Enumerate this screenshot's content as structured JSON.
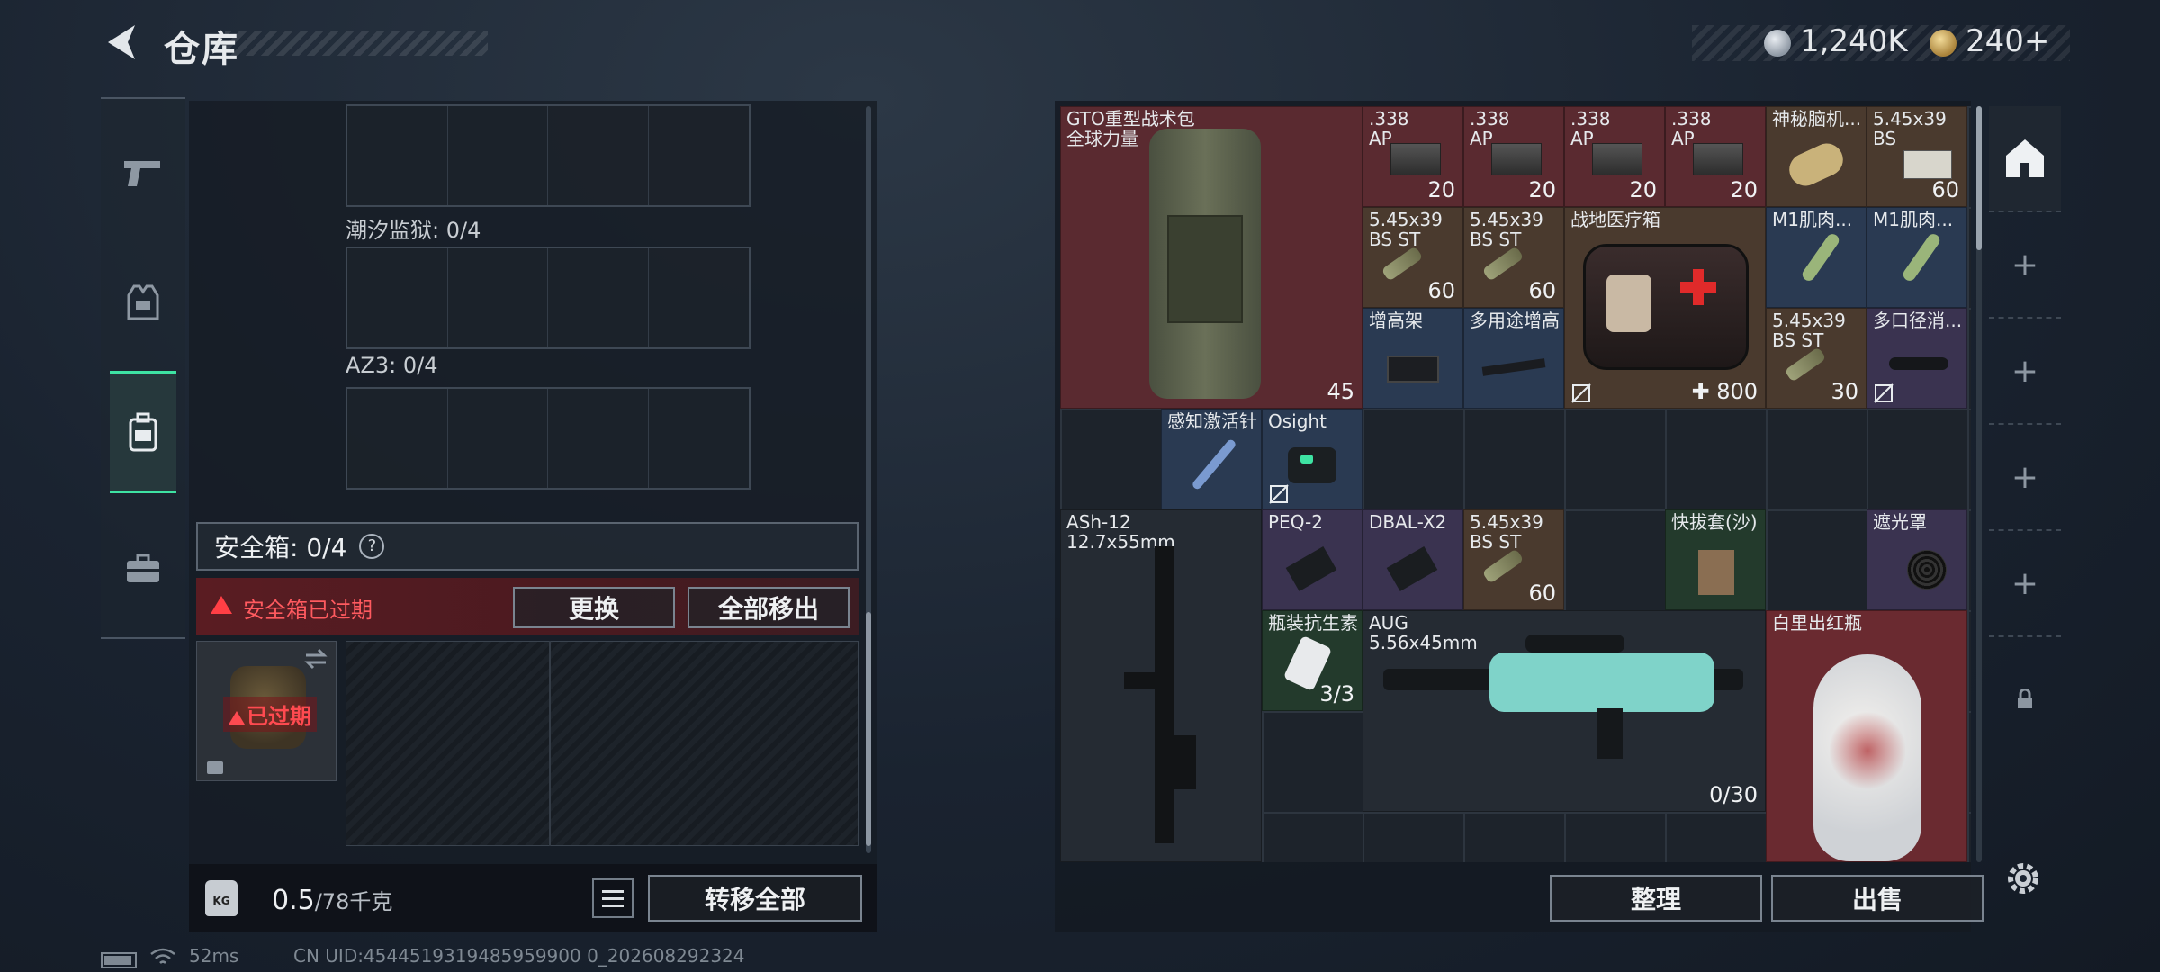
{
  "header": {
    "title": "仓库",
    "currency": [
      {
        "name": "silver-coin",
        "value": "1,240K"
      },
      {
        "name": "gold-coin",
        "value": "240+"
      }
    ]
  },
  "nav": {
    "items": [
      {
        "icon": "pistol-icon",
        "label": ""
      },
      {
        "icon": "vest-icon",
        "label": ""
      },
      {
        "icon": "backpack-icon",
        "label": "",
        "active": true
      },
      {
        "icon": "briefcase-icon",
        "label": ""
      }
    ]
  },
  "left": {
    "slots": [
      {
        "label": ""
      },
      {
        "label": "潮汐监狱: 0/4"
      },
      {
        "label": "AZ3: 0/4"
      }
    ],
    "safebox": {
      "label": "安全箱: 0/4",
      "help": "?"
    },
    "expired_notice": "安全箱已过期",
    "replace_button": "更换",
    "remove_all_button": "全部移出",
    "case_expired_label": "已过期",
    "weight": {
      "current": "0.5",
      "capacity": "/78千克",
      "icon_text": "KG"
    },
    "transfer_all_button": "转移全部"
  },
  "status": {
    "ping": "52ms",
    "uid": "CN UID:4544519319485959900 0_202608292324"
  },
  "stash": {
    "items": [
      {
        "name": "GTO重型战术包\n全球力量",
        "count": "45",
        "color": "red"
      },
      {
        "name": ".338\nAP",
        "count": "20",
        "color": "red"
      },
      {
        "name": ".338\nAP",
        "count": "20",
        "color": "red"
      },
      {
        "name": ".338\nAP",
        "count": "20",
        "color": "red"
      },
      {
        "name": ".338\nAP",
        "count": "20",
        "color": "red"
      },
      {
        "name": "神秘脑机...",
        "count": "",
        "color": "brown"
      },
      {
        "name": "5.45x39\nBS",
        "count": "60",
        "color": "brown"
      },
      {
        "name": "5.45x39\nBS ST",
        "count": "60",
        "color": "brown"
      },
      {
        "name": "5.45x39\nBS ST",
        "count": "60",
        "color": "brown"
      },
      {
        "name": "战地医疗箱",
        "count": "800",
        "color": "brown"
      },
      {
        "name": "M1肌肉...",
        "count": "",
        "color": "blue"
      },
      {
        "name": "M1肌肉...",
        "count": "",
        "color": "blue"
      },
      {
        "name": "增高架",
        "count": "",
        "color": "blue"
      },
      {
        "name": "多用途增高",
        "count": "",
        "color": "blue"
      },
      {
        "name": "5.45x39\nBS ST",
        "count": "30",
        "color": "brown"
      },
      {
        "name": "多口径消...",
        "count": "",
        "color": "purple"
      },
      {
        "name": "感知激活针",
        "count": "",
        "color": "blue"
      },
      {
        "name": "Osight",
        "count": "",
        "color": "blue"
      },
      {
        "name": "ASh-12\n12.7x55mm",
        "count": "",
        "color": "dark"
      },
      {
        "name": "PEQ-2",
        "count": "",
        "color": "purple"
      },
      {
        "name": "DBAL-X2",
        "count": "",
        "color": "purple"
      },
      {
        "name": "5.45x39\nBS ST",
        "count": "60",
        "color": "brown"
      },
      {
        "name": "快拔套(沙)",
        "count": "",
        "color": "green"
      },
      {
        "name": "遮光罩",
        "count": "",
        "color": "purple"
      },
      {
        "name": "瓶装抗生素",
        "count": "3/3",
        "color": "green"
      },
      {
        "name": "AUG\n5.56x45mm",
        "count": "0/30",
        "color": "dark"
      },
      {
        "name": "白里出红瓶",
        "count": "",
        "color": "redbright"
      }
    ],
    "sort_button": "整理",
    "sell_button": "出售"
  },
  "colors": {
    "accent": "#3ee3a3",
    "warning": "#ff4a50",
    "rarity_red": "#5a2a30",
    "rarity_brown": "#4a3a2e",
    "rarity_blue": "#2a3a52",
    "rarity_purple": "#3a3350",
    "rarity_green": "#233a2c"
  }
}
